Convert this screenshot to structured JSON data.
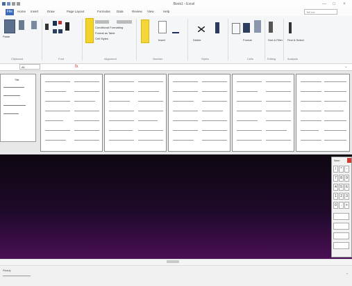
{
  "window": {
    "title": "Book1 - Excel",
    "controls": [
      "—",
      "□",
      "×"
    ]
  },
  "ribbon_tabs": [
    "File",
    "Home",
    "Insert",
    "Draw",
    "Page Layout",
    "Formulas",
    "Data",
    "Review",
    "View",
    "Help"
  ],
  "search": {
    "placeholder": "Tell me"
  },
  "ribbon": {
    "groups": [
      "Clipboard",
      "Font",
      "Alignment",
      "Number",
      "Styles",
      "Cells",
      "Editing",
      "Analysis"
    ],
    "buttons": [
      "Paste",
      "Conditional Formatting",
      "Format as Table",
      "Cell Styles",
      "Insert",
      "Delete",
      "Format",
      "Sort & Filter",
      "Find & Select",
      "Analyze Data"
    ]
  },
  "formula_bar": {
    "name_box": "A1",
    "fx": "fx"
  },
  "left_pane": {
    "title": "Title"
  },
  "keypad": {
    "header": "Num",
    "keys": [
      [
        "/",
        "*",
        "-"
      ],
      [
        "7",
        "8",
        "9"
      ],
      [
        "4",
        "5",
        "6"
      ],
      [
        "1",
        "2",
        "3"
      ],
      [
        "0",
        ".",
        "+"
      ]
    ]
  },
  "status": {
    "text": "Ready"
  }
}
